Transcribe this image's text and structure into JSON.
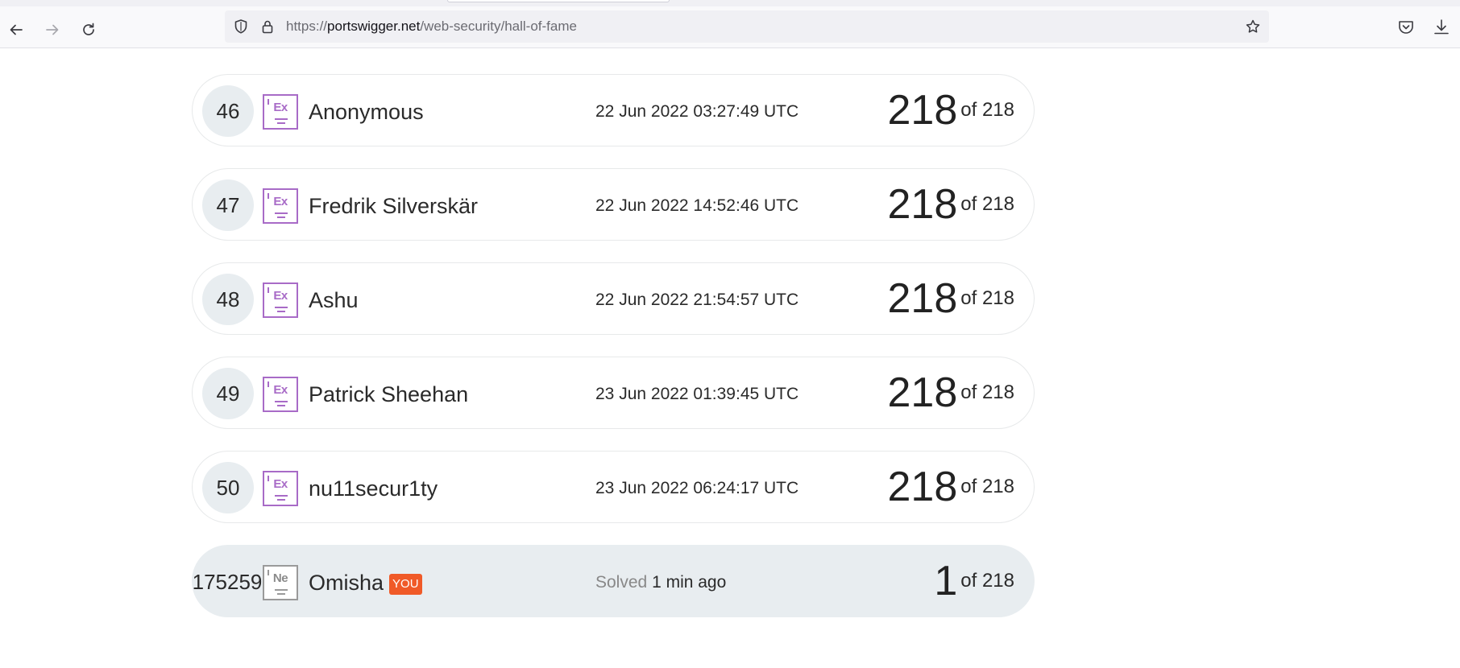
{
  "browser": {
    "url": {
      "scheme": "https://",
      "host": "portswigger.net",
      "path": "/web-security/hall-of-fame"
    }
  },
  "leaderboard": {
    "rows": [
      {
        "rank": "46",
        "badge": "Ex",
        "name": "Anonymous",
        "time": "22 Jun 2022 03:27:49 UTC",
        "score": "218",
        "total": "of 218"
      },
      {
        "rank": "47",
        "badge": "Ex",
        "name": "Fredrik Silverskär",
        "time": "22 Jun 2022 14:52:46 UTC",
        "score": "218",
        "total": "of 218"
      },
      {
        "rank": "48",
        "badge": "Ex",
        "name": "Ashu",
        "time": "22 Jun 2022 21:54:57 UTC",
        "score": "218",
        "total": "of 218"
      },
      {
        "rank": "49",
        "badge": "Ex",
        "name": "Patrick Sheehan",
        "time": "23 Jun 2022 01:39:45 UTC",
        "score": "218",
        "total": "of 218"
      },
      {
        "rank": "50",
        "badge": "Ex",
        "name": "nu11secur1ty",
        "time": "23 Jun 2022 06:24:17 UTC",
        "score": "218",
        "total": "of 218"
      }
    ],
    "current_user": {
      "rank": "175259",
      "badge": "Ne",
      "name": "Omisha",
      "you_label": "YOU",
      "solved_label": "Solved",
      "solved_when": "1 min ago",
      "score": "1",
      "total": "of 218"
    }
  },
  "colors": {
    "expert_badge": "#a86bc7",
    "novice_badge": "#9a9a9a",
    "you_tag": "#f05a28",
    "rank_circle": "#e8edf0"
  }
}
